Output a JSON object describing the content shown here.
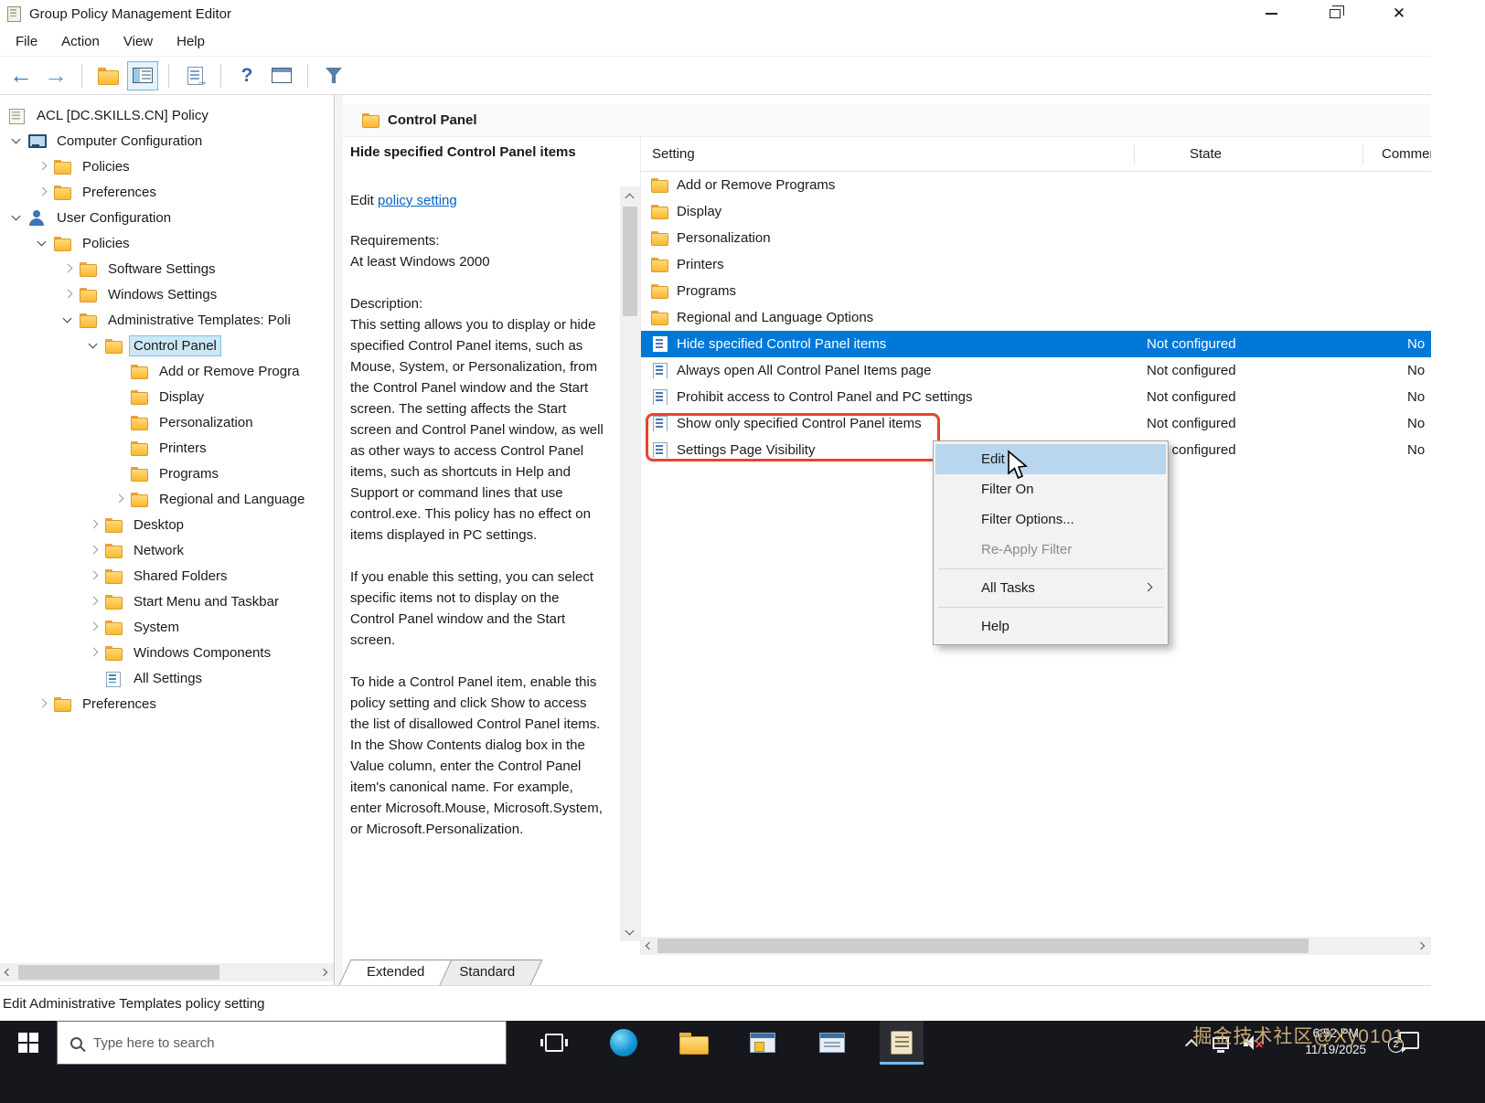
{
  "window": {
    "title": "Group Policy Management Editor"
  },
  "menu": {
    "items": [
      {
        "label": "File"
      },
      {
        "label": "Action"
      },
      {
        "label": "View"
      },
      {
        "label": "Help"
      }
    ]
  },
  "toolbar": {
    "icons": [
      {
        "name": "back-arrow"
      },
      {
        "name": "forward-arrow"
      },
      {
        "separator": true
      },
      {
        "name": "folder-up"
      },
      {
        "name": "console-tree",
        "pressed": true
      },
      {
        "separator": true
      },
      {
        "name": "export-list"
      },
      {
        "separator": true
      },
      {
        "name": "help"
      },
      {
        "name": "properties-window"
      },
      {
        "separator": true
      },
      {
        "name": "filter"
      }
    ]
  },
  "tree": {
    "items": [
      {
        "level": 0,
        "chevron": "hidden",
        "icon": "gpo",
        "label": "ACL [DC.SKILLS.CN] Policy"
      },
      {
        "level": 0,
        "chevron": "down",
        "icon": "computer",
        "label": "Computer Configuration"
      },
      {
        "level": 1,
        "chevron": "right",
        "icon": "folder",
        "label": "Policies"
      },
      {
        "level": 1,
        "chevron": "right",
        "icon": "folder",
        "label": "Preferences"
      },
      {
        "level": 0,
        "chevron": "down",
        "icon": "user",
        "label": "User Configuration"
      },
      {
        "level": 1,
        "chevron": "down",
        "icon": "folder",
        "label": "Policies"
      },
      {
        "level": 2,
        "chevron": "right",
        "icon": "folder",
        "label": "Software Settings"
      },
      {
        "level": 2,
        "chevron": "right",
        "icon": "folder",
        "label": "Windows Settings"
      },
      {
        "level": 2,
        "chevron": "down",
        "icon": "folder",
        "label": "Administrative Templates: Poli"
      },
      {
        "level": 3,
        "chevron": "down",
        "icon": "folder",
        "label": "Control Panel",
        "selected": true
      },
      {
        "level": 4,
        "chevron": "none",
        "icon": "folder",
        "label": "Add or Remove Progra"
      },
      {
        "level": 4,
        "chevron": "none",
        "icon": "folder",
        "label": "Display"
      },
      {
        "level": 4,
        "chevron": "none",
        "icon": "folder",
        "label": "Personalization"
      },
      {
        "level": 4,
        "chevron": "none",
        "icon": "folder",
        "label": "Printers"
      },
      {
        "level": 4,
        "chevron": "none",
        "icon": "folder",
        "label": "Programs"
      },
      {
        "level": 4,
        "chevron": "right",
        "icon": "folder",
        "label": "Regional and Language"
      },
      {
        "level": 3,
        "chevron": "right",
        "icon": "folder",
        "label": "Desktop"
      },
      {
        "level": 3,
        "chevron": "right",
        "icon": "folder",
        "label": "Network"
      },
      {
        "level": 3,
        "chevron": "right",
        "icon": "folder",
        "label": "Shared Folders"
      },
      {
        "level": 3,
        "chevron": "right",
        "icon": "folder",
        "label": "Start Menu and Taskbar"
      },
      {
        "level": 3,
        "chevron": "right",
        "icon": "folder",
        "label": "System"
      },
      {
        "level": 3,
        "chevron": "right",
        "icon": "folder",
        "label": "Windows Components"
      },
      {
        "level": 3,
        "chevron": "none",
        "icon": "allsettings",
        "label": "All Settings"
      },
      {
        "level": 1,
        "chevron": "right",
        "icon": "folder",
        "label": "Preferences"
      }
    ]
  },
  "content": {
    "header": "Control Panel",
    "detail": {
      "title": "Hide specified Control Panel items",
      "edit_prefix": "Edit ",
      "edit_link": "policy setting",
      "requirements_label": "Requirements:",
      "requirements": "At least Windows 2000",
      "description_label": "Description:",
      "paragraphs": [
        {
          "text": "This setting allows you to display or hide specified Control Panel items, such as Mouse, System, or Personalization, from the Control Panel window and the Start screen. The setting affects the Start screen and Control Panel window, as well as other ways to access Control Panel items, such as shortcuts in Help and Support or command lines that use control.exe. This policy has no effect on items displayed in PC settings."
        },
        {
          "text": "If you enable this setting, you can select specific items not to display on the Control Panel window and the Start screen."
        },
        {
          "text": "To hide a Control Panel item, enable this policy setting and click Show to access the list of disallowed Control Panel items. In the Show Contents dialog box in the Value column, enter the Control Panel item's canonical name. For example, enter Microsoft.Mouse, Microsoft.System, or Microsoft.Personalization."
        }
      ]
    },
    "list": {
      "columns": [
        {
          "label": "Setting"
        },
        {
          "label": "State"
        },
        {
          "label": "Comment"
        }
      ],
      "rows": [
        {
          "icon": "folder",
          "label": "Add or Remove Programs"
        },
        {
          "icon": "folder",
          "label": "Display"
        },
        {
          "icon": "folder",
          "label": "Personalization"
        },
        {
          "icon": "folder",
          "label": "Printers"
        },
        {
          "icon": "folder",
          "label": "Programs"
        },
        {
          "icon": "folder",
          "label": "Regional and Language Options"
        },
        {
          "icon": "policy",
          "label": "Hide specified Control Panel items",
          "state": "Not configured",
          "comment": "No",
          "selected": true
        },
        {
          "icon": "policy",
          "label": "Always open All Control Panel Items page",
          "state": "Not configured",
          "comment": "No"
        },
        {
          "icon": "policy",
          "label": "Prohibit access to Control Panel and PC settings",
          "state": "Not configured",
          "comment": "No"
        },
        {
          "icon": "policy",
          "label": "Show only specified Control Panel items",
          "state": "Not configured",
          "comment": "No"
        },
        {
          "icon": "policy",
          "label": "Settings Page Visibility",
          "state": "Not configured",
          "comment": "No"
        }
      ]
    },
    "tabs": [
      {
        "label": "Extended",
        "active": true
      },
      {
        "label": "Standard"
      }
    ]
  },
  "context_menu": {
    "items": [
      {
        "label": "Edit",
        "highlighted": true
      },
      {
        "label": "Filter On"
      },
      {
        "label": "Filter Options..."
      },
      {
        "label": "Re-Apply Filter",
        "disabled": true
      },
      {
        "separator": true
      },
      {
        "label": "All Tasks",
        "submenu": true
      },
      {
        "separator": true
      },
      {
        "label": "Help"
      }
    ]
  },
  "statusbar": {
    "text": "Edit Administrative Templates policy setting"
  },
  "taskbar": {
    "search_placeholder": "Type here to search",
    "watermark": "掘金技术社区@Xy0101",
    "clock": {
      "time": "6:52 PM",
      "date": "11/19/2025"
    },
    "notification_badge": "2"
  },
  "annotation": {
    "color": "#e8442c",
    "selection_color": "#0078d7"
  }
}
